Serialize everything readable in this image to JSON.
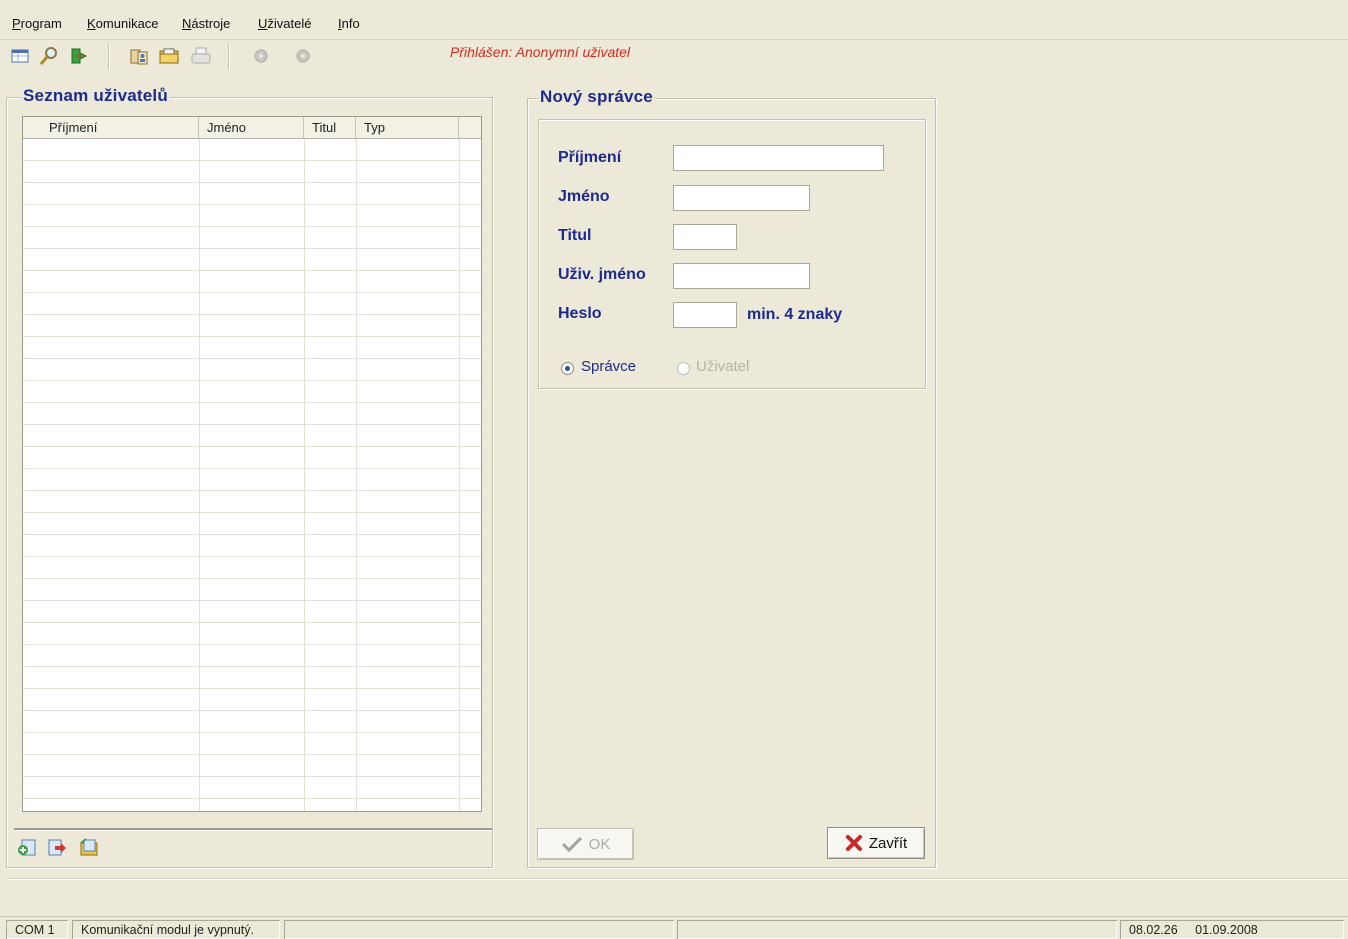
{
  "menu": {
    "items": [
      {
        "accel": "P",
        "rest": "rogram"
      },
      {
        "accel": "K",
        "rest": "omunikace"
      },
      {
        "accel": "N",
        "rest": "ástroje"
      },
      {
        "accel": "U",
        "rest": "živatelé"
      },
      {
        "accel": "I",
        "rest": "nfo"
      }
    ]
  },
  "toolbar": {
    "login_status": "Přihlášen: Anonymní uživatel",
    "icons": [
      "table-icon",
      "search-icon",
      "exit-icon",
      "users-icon",
      "folder-icon",
      "print-icon",
      "disc-icon",
      "disc-icon"
    ]
  },
  "user_list": {
    "title": "Seznam uživatelů",
    "columns": [
      "Příjmení",
      "Jméno",
      "Titul",
      "Typ"
    ],
    "rows": [],
    "footer_icons": [
      "add-user-icon",
      "export-icon",
      "open-folder-icon"
    ]
  },
  "new_admin": {
    "title": "Nový správce",
    "labels": {
      "surname": "Příjmení",
      "firstname": "Jméno",
      "title": "Titul",
      "username": "Uživ. jméno",
      "password": "Heslo",
      "password_hint": "min. 4 znaky"
    },
    "values": {
      "surname": "",
      "firstname": "",
      "title": "",
      "username": "",
      "password": ""
    },
    "roles": {
      "admin": "Správce",
      "user": "Uživatel",
      "selected": "admin"
    },
    "buttons": {
      "ok": "OK",
      "close": "Zavřít"
    }
  },
  "statusbar": {
    "port": "COM 1",
    "message": "Komunikační modul je vypnutý.",
    "time": "08.02.26",
    "date": "01.09.2008"
  }
}
